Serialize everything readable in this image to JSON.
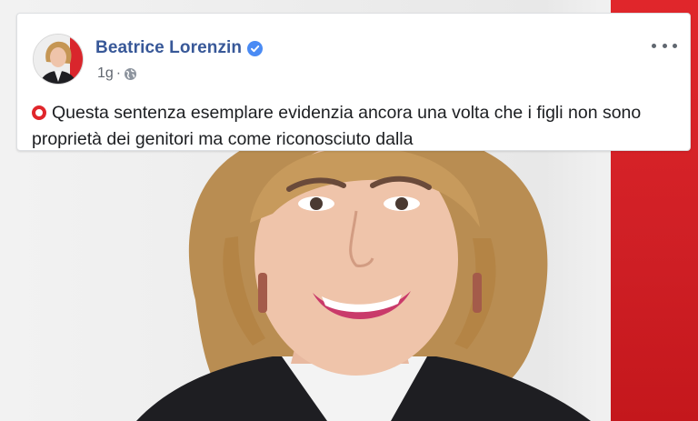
{
  "post": {
    "author": "Beatrice Lorenzin",
    "time": "1g",
    "separator": "·",
    "text_line1": "Questa sentenza esemplare evidenzia ancora una volta che i figli non sono",
    "text_line2": "proprietà dei genitori ma come riconosciuto dalla"
  },
  "colors": {
    "author_link": "#385898",
    "verified_badge": "#4a8bf4",
    "emoji_circle": "#e0262b",
    "background_panel": "#cf1f25"
  },
  "icons": {
    "verified": "verified-badge-icon",
    "audience": "globe-icon",
    "options": "more-options-icon",
    "bullet": "red-circle-icon"
  }
}
